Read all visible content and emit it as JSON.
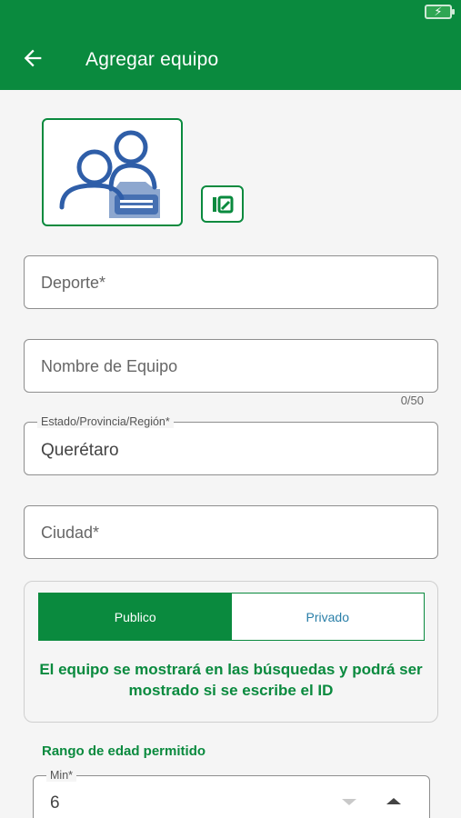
{
  "status": {
    "battery_icon": "battery-charging-icon",
    "battery_symbol": "⚡"
  },
  "appbar": {
    "title": "Agregar equipo",
    "back_icon": "back-arrow-icon"
  },
  "photo": {
    "icon": "team-avatar-icon",
    "edit_icon": "edit-image-icon"
  },
  "form": {
    "sport_placeholder": "Deporte*",
    "team_name_placeholder": "Nombre de Equipo",
    "team_name_counter": "0/50",
    "state_label": "Estado/Provincia/Región*",
    "state_value": "Querétaro",
    "city_placeholder": "Ciudad*"
  },
  "visibility": {
    "options": [
      "Publico",
      "Privado"
    ],
    "selected": "Publico",
    "message": "El equipo se mostrará en las búsquedas y podrá ser mostrado si se escribe el ID"
  },
  "age_range": {
    "title": "Rango de edad permitido",
    "min_label": "Min*",
    "min_value": "6"
  },
  "colors": {
    "primary": "#0a8a3e",
    "link": "#2a7fa8"
  }
}
